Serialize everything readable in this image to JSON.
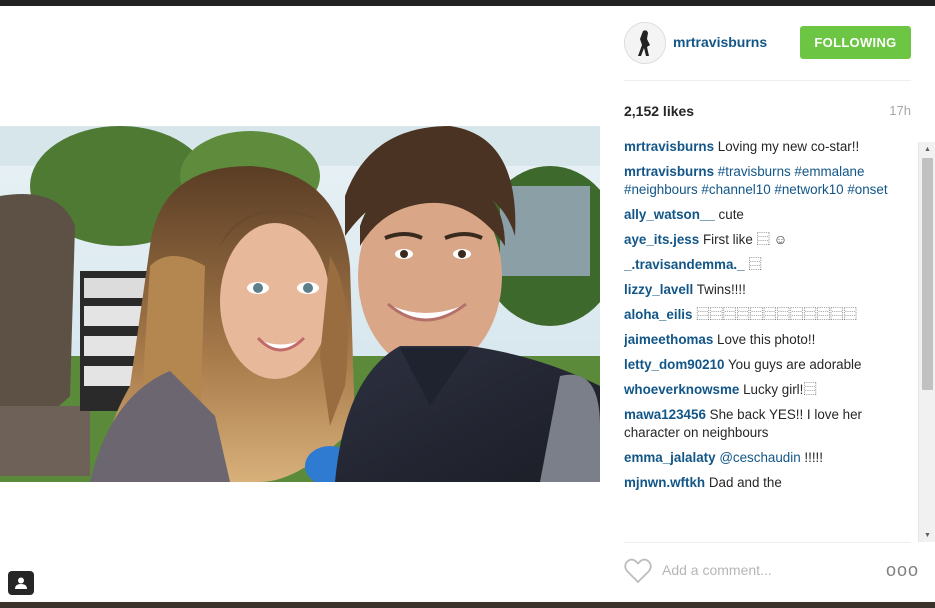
{
  "post": {
    "author": "mrtravisburns",
    "follow_label": "FOLLOWING",
    "likes": "2,152 likes",
    "time": "17h"
  },
  "comments": [
    {
      "user": "mrtravisburns",
      "text": "Loving my new co-star!!"
    },
    {
      "user": "mrtravisburns",
      "text": "#travisburns #emmalane #neighbours #channel10 #network10 #onset"
    },
    {
      "user": "ally_watson__",
      "text": "cute"
    },
    {
      "user": "aye_its.jess",
      "text": "First like ⿳ ☺"
    },
    {
      "user": "_.travisandemma._",
      "text": "⿳"
    },
    {
      "user": "lizzy_lavell",
      "text": "Twins!!!!"
    },
    {
      "user": "aloha_eilis",
      "text": "⿳⿳⿳⿳⿳⿳⿳⿳⿳⿳⿳⿳"
    },
    {
      "user": "jaimeethomas",
      "text": "Love this photo!!"
    },
    {
      "user": "letty_dom90210",
      "text": "You guys are adorable"
    },
    {
      "user": "whoeverknowsme",
      "text": "Lucky girl!⿳"
    },
    {
      "user": "mawa123456",
      "text": "She back YES!! I love her character on neighbours"
    },
    {
      "user": "emma_jalalaty",
      "mention": "@ceschaudin",
      "text": "!!!!!"
    },
    {
      "user": "mjnwn.wftkh",
      "text": "Dad and the"
    }
  ],
  "comment_box": {
    "placeholder": "Add a comment...",
    "more_label": "ooo"
  },
  "colors": {
    "follow_green": "#6cc644",
    "username_blue": "#125688"
  },
  "icons": {
    "like": "heart-icon",
    "user_tag": "user-tag-icon",
    "more": "more-options-icon"
  }
}
